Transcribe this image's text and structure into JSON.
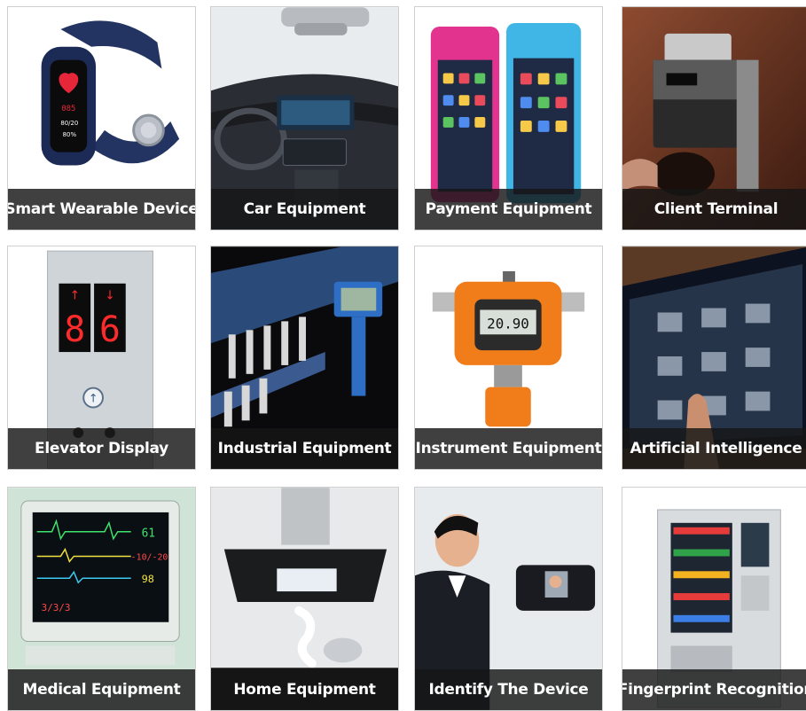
{
  "grid": {
    "items": [
      {
        "label": "Smart Wearable Device",
        "icon": "smart-band-icon"
      },
      {
        "label": "Car Equipment",
        "icon": "car-dashboard-icon"
      },
      {
        "label": "Payment Equipment",
        "icon": "pos-terminal-icon"
      },
      {
        "label": "Client Terminal",
        "icon": "coffee-machine-icon"
      },
      {
        "label": "Elevator Display",
        "icon": "elevator-panel-icon"
      },
      {
        "label": "Industrial Equipment",
        "icon": "industrial-machine-icon"
      },
      {
        "label": "Instrument Equipment",
        "icon": "gas-detector-icon"
      },
      {
        "label": "Artificial Intelligence",
        "icon": "ai-tablet-icon"
      },
      {
        "label": "Medical Equipment",
        "icon": "patient-monitor-icon"
      },
      {
        "label": "Home Equipment",
        "icon": "range-hood-icon"
      },
      {
        "label": "Identify The Device",
        "icon": "face-recognition-icon"
      },
      {
        "label": "Fingerprint Recognition",
        "icon": "vending-machine-icon"
      }
    ]
  },
  "screens": {
    "band_reading_1": "085",
    "band_reading_2": "80/20",
    "band_reading_3": "80%",
    "elevator_left_arrow": "↑",
    "elevator_right_arrow": "↓",
    "elevator_left_digit": "8",
    "elevator_right_digit": "6",
    "elevator_call_arrow": "↑",
    "detector_value": "20.90",
    "monitor_value_1": "61",
    "monitor_value_2": "-10/-20",
    "monitor_value_3": "98",
    "monitor_value_4": "3/3/3"
  },
  "colors": {
    "caption_bg": "#161616",
    "caption_text": "#ffffff",
    "elevator_led": "#ff2a2a",
    "detector_orange": "#f07c1a",
    "pos_pink": "#e2338f",
    "pos_blue": "#40b6e6"
  }
}
